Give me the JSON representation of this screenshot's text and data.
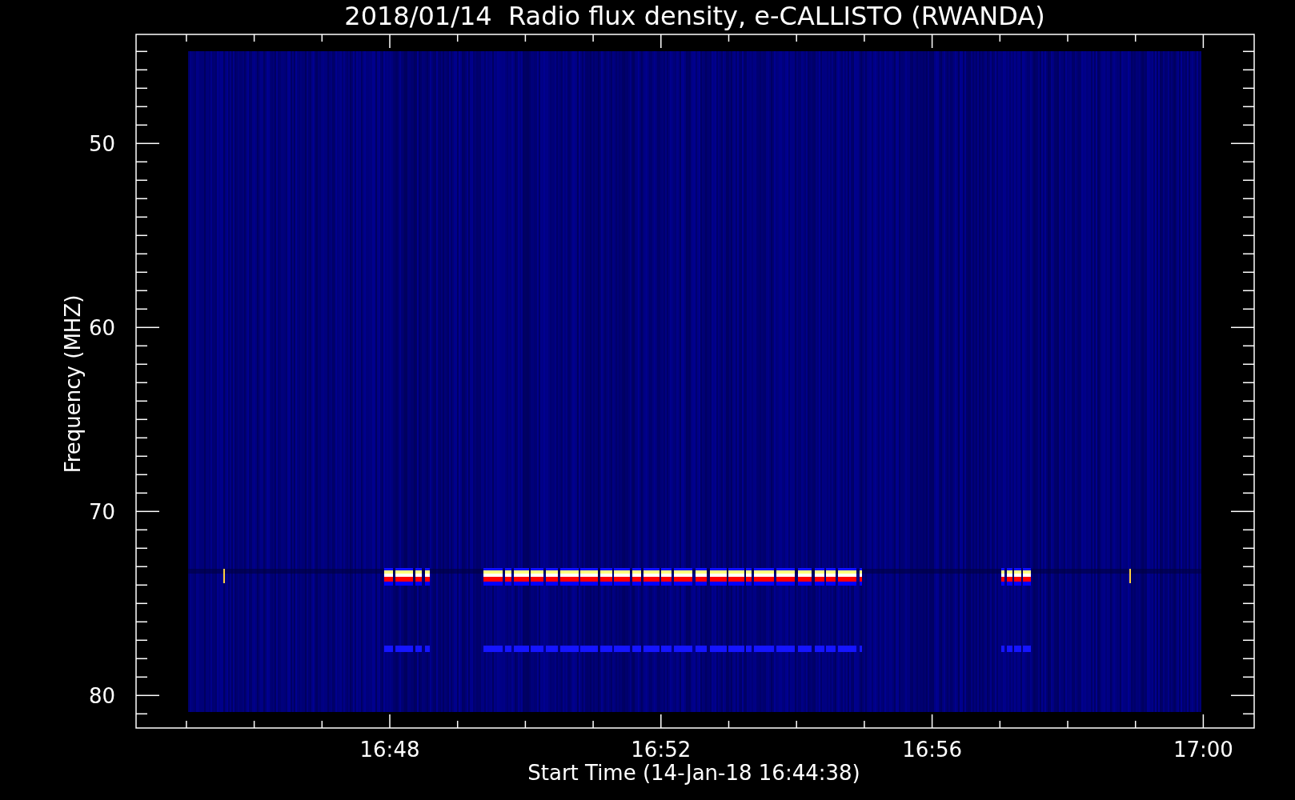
{
  "title": "2018/01/14  Radio flux density, e-CALLISTO (RWANDA)",
  "y_axis": {
    "label": "Frequency (MHZ)",
    "tick_labels": [
      "50",
      "60",
      "70",
      "80"
    ]
  },
  "x_axis": {
    "label": "Start Time (14-Jan-18 16:44:38)",
    "tick_labels": [
      "16:48",
      "16:52",
      "16:56",
      "17:00"
    ]
  }
}
